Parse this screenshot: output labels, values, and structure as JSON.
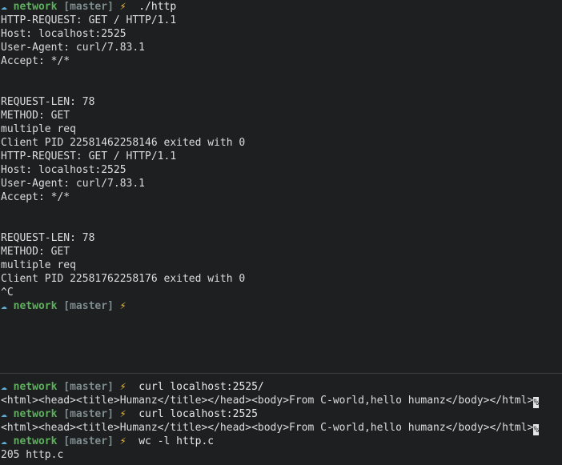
{
  "prompt": {
    "cloud": "☁",
    "dir": "network",
    "branch": "[master]",
    "bolt": "⚡"
  },
  "top_pane": {
    "lines": [
      {
        "type": "prompt",
        "cmd": "./http"
      },
      {
        "type": "text",
        "text": "HTTP-REQUEST: GET / HTTP/1.1"
      },
      {
        "type": "text",
        "text": "Host: localhost:2525"
      },
      {
        "type": "text",
        "text": "User-Agent: curl/7.83.1"
      },
      {
        "type": "text",
        "text": "Accept: */*"
      },
      {
        "type": "text",
        "text": ""
      },
      {
        "type": "text",
        "text": ""
      },
      {
        "type": "text",
        "text": "REQUEST-LEN: 78"
      },
      {
        "type": "text",
        "text": "METHOD: GET"
      },
      {
        "type": "text",
        "text": "multiple req"
      },
      {
        "type": "text",
        "text": "Client PID 22581462258146 exited with 0"
      },
      {
        "type": "text",
        "text": "HTTP-REQUEST: GET / HTTP/1.1"
      },
      {
        "type": "text",
        "text": "Host: localhost:2525"
      },
      {
        "type": "text",
        "text": "User-Agent: curl/7.83.1"
      },
      {
        "type": "text",
        "text": "Accept: */*"
      },
      {
        "type": "text",
        "text": ""
      },
      {
        "type": "text",
        "text": ""
      },
      {
        "type": "text",
        "text": "REQUEST-LEN: 78"
      },
      {
        "type": "text",
        "text": "METHOD: GET"
      },
      {
        "type": "text",
        "text": "multiple req"
      },
      {
        "type": "text",
        "text": "Client PID 22581762258176 exited with 0"
      },
      {
        "type": "text",
        "text": "^C"
      },
      {
        "type": "prompt",
        "cmd": ""
      }
    ]
  },
  "bottom_pane": {
    "lines": [
      {
        "type": "prompt",
        "cmd": "curl localhost:2525/"
      },
      {
        "type": "text",
        "text": "<html><head><title>Humanz</title></head><body>From C-world,hello humanz</body></html>",
        "cursor": "%"
      },
      {
        "type": "prompt",
        "cmd": "curl localhost:2525"
      },
      {
        "type": "text",
        "text": "<html><head><title>Humanz</title></head><body>From C-world,hello humanz</body></html>",
        "cursor": "%"
      },
      {
        "type": "prompt",
        "cmd": "wc -l http.c"
      },
      {
        "type": "text",
        "text": "205 http.c"
      }
    ]
  }
}
